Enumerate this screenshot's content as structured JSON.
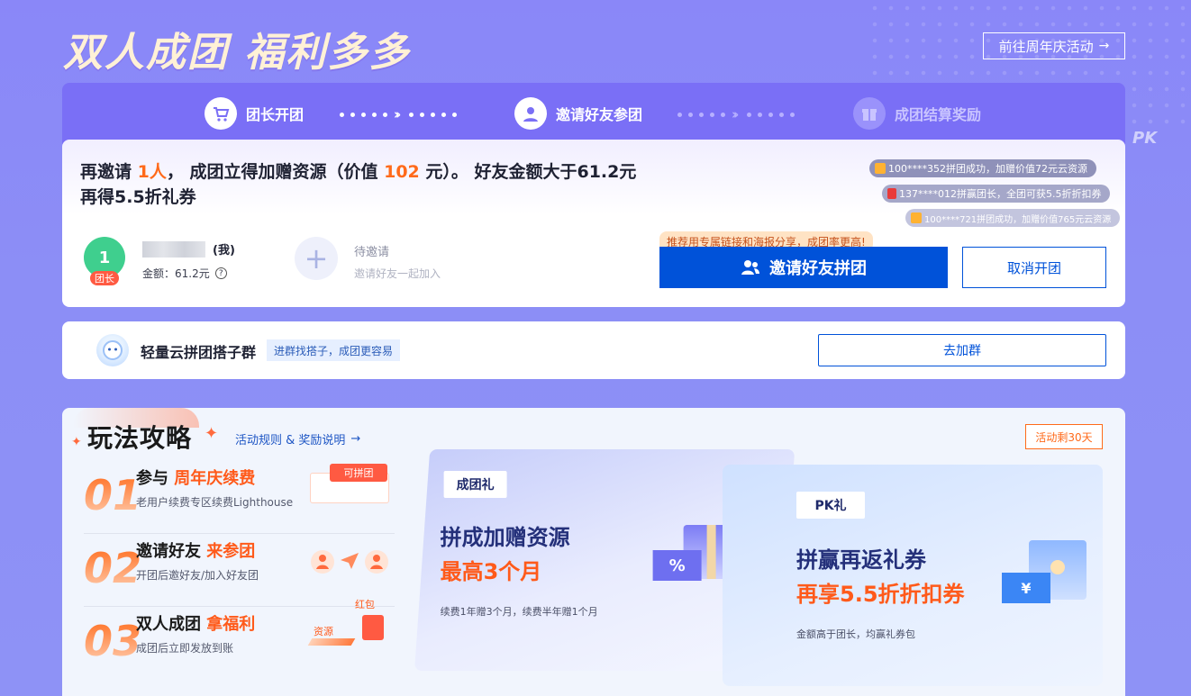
{
  "headline": "双人成团  福利多多",
  "goto": {
    "label": "前往周年庆活动",
    "arrow": "→"
  },
  "steps": [
    {
      "label": "团长开团",
      "icon": "cart-icon"
    },
    {
      "label": "邀请好友参团",
      "icon": "user-icon"
    },
    {
      "label": "成团结算奖励",
      "icon": "gift-icon"
    }
  ],
  "invite": {
    "line1_a": "再邀请 ",
    "count": "1人",
    "line1_b": "， 成团立得加赠资源（价值 ",
    "value": "102",
    "line1_c": " 元）。 好友金额大于61.2元",
    "line2": "再得5.5折礼券"
  },
  "leader": {
    "number": "1",
    "tag": "团长",
    "me": "(我)",
    "amount": "金额：61.2元",
    "help": "?"
  },
  "pending": {
    "plus": "+",
    "label": "待邀请",
    "sub": "邀请好友一起加入"
  },
  "tickers": [
    "100****352拼团成功，加赠价值72元云资源",
    "137****012拼赢团长，全团可获5.5折折扣券",
    "100****721拼团成功，加赠价值765元云资源"
  ],
  "hint": "推荐用专属链接和海报分享，成团率更高!",
  "buttons": {
    "invite": "邀请好友拼团",
    "cancel": "取消开团",
    "join": "去加群"
  },
  "group": {
    "title": "轻量云拼团搭子群",
    "tag": "进群找搭子，成团更容易"
  },
  "guide": {
    "title": "玩法攻略",
    "rules": "活动规则 & 奖励说明",
    "rules_arrow": "→",
    "days_left": "活动剩30天",
    "items": [
      {
        "num": "01",
        "title_a": "参与 ",
        "title_b": "周年庆续费",
        "desc": "老用户续费专区续费Lighthouse",
        "badge": "可拼团"
      },
      {
        "num": "02",
        "title_a": "邀请好友 ",
        "title_b": "来参团",
        "desc": "开团后邀好友/加入好友团"
      },
      {
        "num": "03",
        "title_a": "双人成团 ",
        "title_b": "拿福利",
        "desc": "成团后立即发放到账",
        "label_a": "红包",
        "label_b": "资源"
      }
    ]
  },
  "reward1": {
    "tag": "成团礼",
    "head": "拼成加赠资源",
    "sub": "最高3个月",
    "note": "续费1年赠3个月，续费半年赠1个月",
    "badge": "%"
  },
  "reward2": {
    "tag": "PK礼",
    "head": "拼赢再返礼券",
    "sub": "再享5.5折折扣券",
    "note": "金额高于团长，均赢礼券包",
    "badge": "¥"
  },
  "pk_mark": "PK",
  "colors": {
    "accent": "#0052d9",
    "highlight": "#ff6a1a",
    "bg": "#8a87f8"
  }
}
